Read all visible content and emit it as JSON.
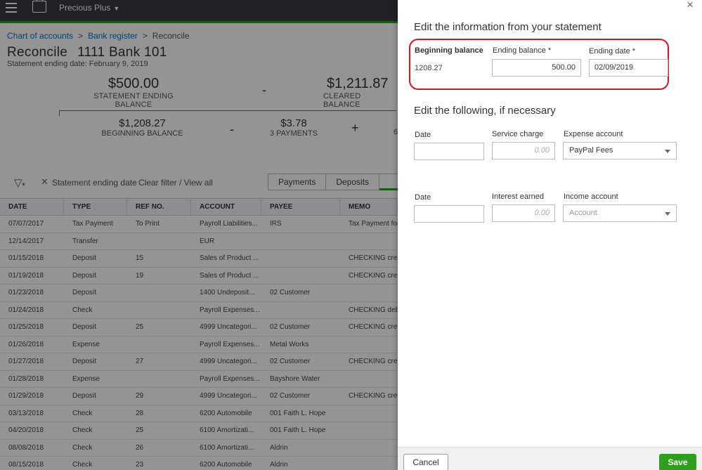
{
  "topbar": {
    "company": "Precious Plus"
  },
  "breadcrumb": {
    "item1": "Chart of accounts",
    "item2": "Bank register",
    "item3": "Reconcile",
    "sep": ">"
  },
  "page": {
    "title": "Reconcile",
    "account": "1111 Bank 101",
    "statement_date": "Statement ending date: February 9, 2019"
  },
  "summary": {
    "ending_amount": "$500.00",
    "ending_label": "STATEMENT ENDING BALANCE",
    "op_minus1": "-",
    "cleared_amount": "$1,211.87",
    "cleared_label": "CLEARED BALANCE",
    "beginning_amount": "$1,208.27",
    "beginning_label": "BEGINNING BALANCE",
    "op_minus2": "-",
    "payments_amount": "$3.78",
    "payments_label": "3 PAYMENTS",
    "op_plus": "+",
    "deposits_partial": "6"
  },
  "filter": {
    "filter_text": "Statement ending date",
    "clear_text": "Clear filter / View all"
  },
  "tabs": [
    "Payments",
    "Deposits",
    ""
  ],
  "grid": {
    "headers": [
      "DATE",
      "TYPE",
      "REF NO.",
      "ACCOUNT",
      "PAYEE",
      "MEMO"
    ],
    "rows": [
      [
        "07/07/2017",
        "Tax Payment",
        "To Print",
        "Payroll Liabilities...",
        "IRS",
        "Tax Payment for"
      ],
      [
        "12/14/2017",
        "Transfer",
        "",
        "EUR",
        "",
        ""
      ],
      [
        "01/15/2018",
        "Deposit",
        "15",
        "Sales of Product ...",
        "",
        "CHECKING crec"
      ],
      [
        "01/19/2018",
        "Deposit",
        "19",
        "Sales of Product ...",
        "",
        "CHECKING crec"
      ],
      [
        "01/23/2018",
        "Deposit",
        "",
        "1400 Undeposit...",
        "02 Customer",
        ""
      ],
      [
        "01/24/2018",
        "Check",
        "",
        "Payroll Expenses...",
        "",
        "CHECKING deb"
      ],
      [
        "01/25/2018",
        "Deposit",
        "25",
        "4999 Uncategori...",
        "02 Customer",
        "CHECKING crec"
      ],
      [
        "01/26/2018",
        "Expense",
        "",
        "Payroll Expenses...",
        "Metal Works",
        ""
      ],
      [
        "01/27/2018",
        "Deposit",
        "27",
        "4999 Uncategori...",
        "02 Customer",
        "CHECKING crec"
      ],
      [
        "01/28/2018",
        "Expense",
        "",
        "Payroll Expenses...",
        "Bayshore Water",
        ""
      ],
      [
        "01/29/2018",
        "Deposit",
        "29",
        "4999 Uncategori...",
        "02 Customer",
        "CHECKING crec"
      ],
      [
        "03/13/2018",
        "Check",
        "28",
        "6200 Automobile",
        "001 Faith L. Hope",
        ""
      ],
      [
        "04/20/2018",
        "Check",
        "25",
        "6100 Amortizati...",
        "001 Faith L. Hope",
        ""
      ],
      [
        "08/08/2018",
        "Check",
        "26",
        "6100 Amortizati...",
        "Aldrin",
        ""
      ],
      [
        "08/15/2018",
        "Check",
        "23",
        "6200 Automobile",
        "Aldrin",
        ""
      ]
    ]
  },
  "drawer": {
    "section1_title": "Edit the information from your statement",
    "beginning_label": "Beginning balance",
    "beginning_value": "1208.27",
    "ending_label": "Ending balance *",
    "ending_value": "500.00",
    "ending_date_label": "Ending date *",
    "ending_date_value": "02/09/2019",
    "section2_title": "Edit the following, if necessary",
    "date_label_1": "Date",
    "service_charge_label": "Service charge",
    "service_charge_placeholder": "0.00",
    "expense_account_label": "Expense account",
    "expense_account_value": "PayPal Fees",
    "date_label_2": "Date",
    "interest_label": "Interest earned",
    "interest_placeholder": "0.00",
    "income_account_label": "Income account",
    "income_account_placeholder": "Account",
    "cancel_label": "Cancel",
    "save_label": "Save",
    "close_glyph": "×"
  },
  "colors": {
    "accent": "#2ca01c",
    "highlight": "#e0101e",
    "link": "#0077c5",
    "topbar": "#393a3d"
  }
}
